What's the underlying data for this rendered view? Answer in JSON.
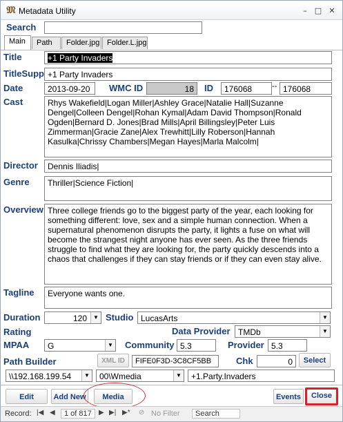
{
  "window": {
    "title": "Metadata Utility",
    "icon": "app-icon",
    "minimize": "–",
    "maximize": "□",
    "close": "✕"
  },
  "search": {
    "label": "Search",
    "value": ""
  },
  "tabs": [
    {
      "label": "Main"
    },
    {
      "label": "Path"
    },
    {
      "label": "Folder.jpg"
    },
    {
      "label": "Folder.L.jpg"
    }
  ],
  "fields": {
    "title": {
      "label": "Title",
      "value": "+1 Party Invaders"
    },
    "titlesupp": {
      "label": "TitleSupp",
      "value": "+1 Party Invaders"
    },
    "date": {
      "label": "Date",
      "value": "2013-09-20"
    },
    "wmc_id": {
      "label": "WMC ID",
      "value": "18"
    },
    "id": {
      "label": "ID",
      "value": "176068",
      "sep": "--",
      "value2": "176068"
    },
    "cast": {
      "label": "Cast",
      "value": "Rhys Wakefield|Logan Miller|Ashley Grace|Natalie Hall|Suzanne Dengel|Colleen Dengel|Rohan Kymal|Adam David Thompson|Ronald Ogden|Bernard D. Jones|Brad Mills|April Billingsley|Peter Luis Zimmerman|Gracie Zane|Alex Trewhitt|Lilly Roberson|Hannah Kasulka|Chrissy Chambers|Megan Hayes|Marla Malcolm|"
    },
    "director": {
      "label": "Director",
      "value": "Dennis Iliadis|"
    },
    "genre": {
      "label": "Genre",
      "value": "Thriller|Science Fiction|"
    },
    "overview": {
      "label": "Overview",
      "value": "Three college friends go to the biggest party of the year, each looking for something different: love, sex and a simple human connection. When a supernatural phenomenon disrupts the party, it lights a fuse on what will become the strangest night anyone has ever seen. As the three friends struggle to find what they are looking for, the party quickly descends into a chaos that challenges if they can stay friends or if they can even stay alive."
    },
    "tagline": {
      "label": "Tagline",
      "value": "Everyone wants one."
    },
    "duration": {
      "label": "Duration",
      "value": "120"
    },
    "studio": {
      "label": "Studio",
      "value": "LucasArts"
    },
    "rating": {
      "label": "Rating"
    },
    "data_provider": {
      "label": "Data Provider",
      "value": "TMDb"
    },
    "mpaa": {
      "label": "MPAA",
      "value": "G"
    },
    "community": {
      "label": "Community",
      "value": "5.3"
    },
    "provider": {
      "label": "Provider",
      "value": "5.3"
    },
    "path_builder": {
      "label": "Path Builder",
      "xml_id": "XML ID",
      "hash": "FIFE0F3D-3C8CF5BB",
      "chk_label": "Chk",
      "chk_value": "0",
      "select_label": "Select"
    },
    "path": {
      "server": "\\\\192.168.199.54",
      "share": "00\\Wmedia",
      "folder": "+1.Party.Invaders"
    }
  },
  "buttons": {
    "edit_record": "Edit Record",
    "add_new": "Add New",
    "media": "Media",
    "events": "Events",
    "close": "Close"
  },
  "status": {
    "record_label": "Record:",
    "record_text": "1 of 817",
    "filter": "No Filter",
    "search": "Search"
  },
  "colors": {
    "label": "#1a3f7a",
    "close_highlight": "#d4212a",
    "media_circle": "#c7303a",
    "selection": "#000000"
  }
}
